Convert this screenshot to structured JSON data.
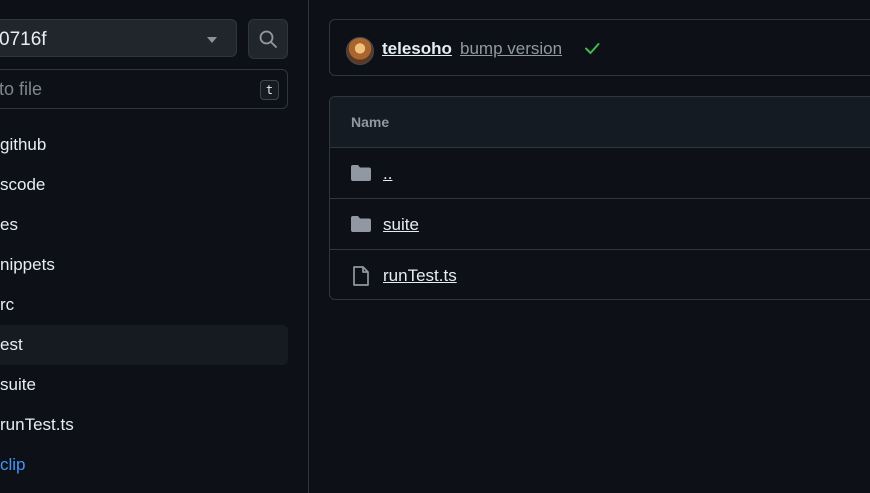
{
  "sidebar": {
    "branch_label": "0716f",
    "search_placeholder": "to file",
    "shortcut_key": "t",
    "items": [
      {
        "label": "github"
      },
      {
        "label": "scode"
      },
      {
        "label": "es"
      },
      {
        "label": "nippets"
      },
      {
        "label": "rc"
      },
      {
        "label": "est"
      },
      {
        "label": "suite"
      },
      {
        "label": "runTest.ts"
      },
      {
        "label": "clip"
      }
    ]
  },
  "commit": {
    "author": "telesoho",
    "message": "bump version",
    "status": "success"
  },
  "files": {
    "header": "Name",
    "rows": [
      {
        "name": "..",
        "icon": "folder-icon"
      },
      {
        "name": "suite",
        "icon": "folder-icon"
      },
      {
        "name": "runTest.ts",
        "icon": "file-icon"
      }
    ]
  },
  "colors": {
    "background": "#0d1117",
    "border": "#30363d",
    "link": "#4493f8",
    "success": "#3fb950"
  }
}
